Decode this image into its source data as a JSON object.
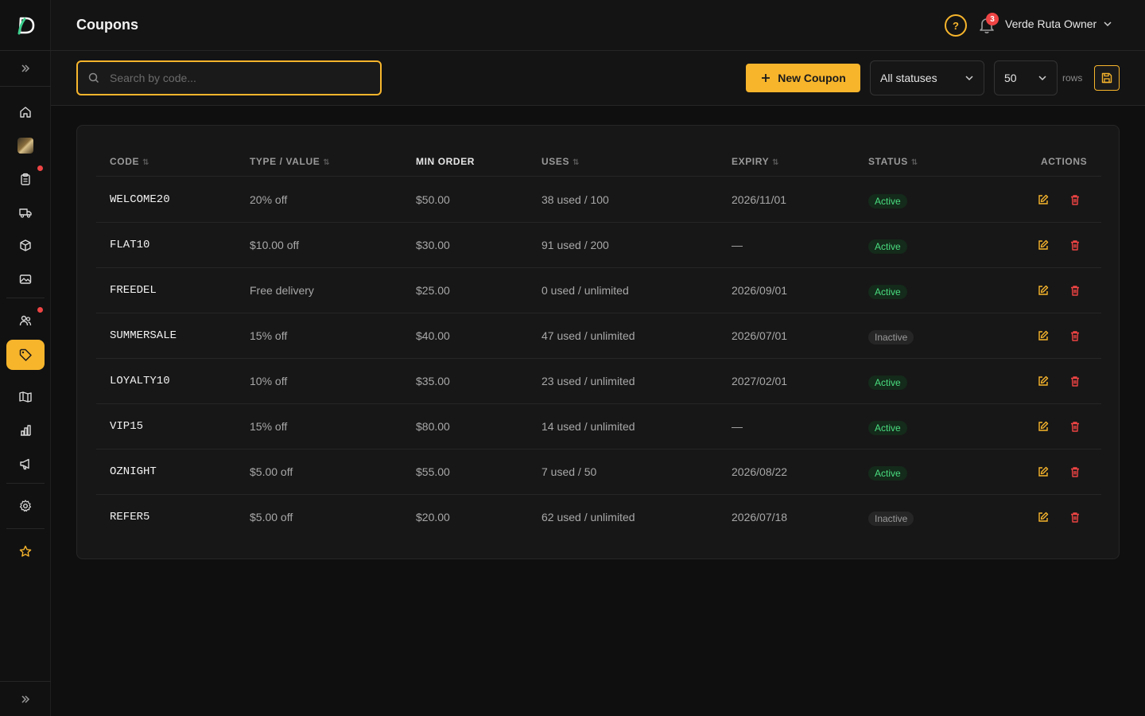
{
  "app": {
    "logo_letter": "D"
  },
  "header": {
    "title": "Coupons",
    "help_label": "?",
    "notifications_count": "3",
    "user_name": "Verde Ruta Owner"
  },
  "toolbar": {
    "search_placeholder": "Search by code...",
    "new_button_label": "New Coupon",
    "status_filter_value": "All statuses",
    "rows_value": "50",
    "rows_label": "rows"
  },
  "table": {
    "columns": {
      "code": "CODE",
      "type_value": "TYPE / VALUE",
      "min_order": "MIN ORDER",
      "uses": "USES",
      "expiry": "EXPIRY",
      "status": "STATUS",
      "actions": "ACTIONS"
    },
    "rows": [
      {
        "code": "WELCOME20",
        "type_value": "20% off",
        "min_order": "$50.00",
        "uses": "38 used / 100",
        "expiry": "2026/11/01",
        "status": "Active"
      },
      {
        "code": "FLAT10",
        "type_value": "$10.00 off",
        "min_order": "$30.00",
        "uses": "91 used / 200",
        "expiry": "—",
        "status": "Active"
      },
      {
        "code": "FREEDEL",
        "type_value": "Free delivery",
        "min_order": "$25.00",
        "uses": "0 used / unlimited",
        "expiry": "2026/09/01",
        "status": "Active"
      },
      {
        "code": "SUMMERSALE",
        "type_value": "15% off",
        "min_order": "$40.00",
        "uses": "47 used / unlimited",
        "expiry": "2026/07/01",
        "status": "Inactive"
      },
      {
        "code": "LOYALTY10",
        "type_value": "10% off",
        "min_order": "$35.00",
        "uses": "23 used / unlimited",
        "expiry": "2027/02/01",
        "status": "Active"
      },
      {
        "code": "VIP15",
        "type_value": "15% off",
        "min_order": "$80.00",
        "uses": "14 used / unlimited",
        "expiry": "—",
        "status": "Active"
      },
      {
        "code": "OZNIGHT",
        "type_value": "$5.00 off",
        "min_order": "$55.00",
        "uses": "7 used / 50",
        "expiry": "2026/08/22",
        "status": "Active"
      },
      {
        "code": "REFER5",
        "type_value": "$5.00 off",
        "min_order": "$20.00",
        "uses": "62 used / unlimited",
        "expiry": "2026/07/18",
        "status": "Inactive"
      }
    ]
  },
  "colors": {
    "accent": "#f7b52c",
    "danger": "#ef4444",
    "active_text": "#4ade80"
  }
}
